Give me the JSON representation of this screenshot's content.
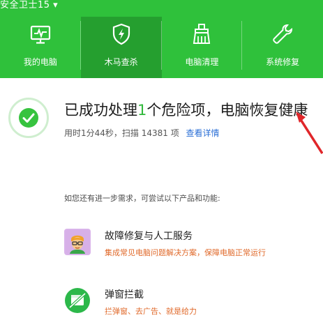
{
  "app": {
    "brand_text": "安全卫士15 ▾"
  },
  "nav": [
    {
      "label": "我的电脑",
      "icon": "monitor-pulse-icon",
      "active": false
    },
    {
      "label": "木马查杀",
      "icon": "shield-bolt-icon",
      "active": true
    },
    {
      "label": "电脑清理",
      "icon": "broom-icon",
      "active": false
    },
    {
      "label": "系统修复",
      "icon": "wrench-icon",
      "active": false
    }
  ],
  "result": {
    "headline_pre": "已成功处理",
    "headline_num": "1",
    "headline_post": "个危险项，电脑恢复健康",
    "summary": "用时1分44秒，扫描 14381 项",
    "detail_link": "查看详情"
  },
  "hint": "如您还有进一步需求，可尝试以下产品和功能:",
  "recommendations": [
    {
      "title": "故障修复与人工服务",
      "desc": "集成常见电脑问题解决方案，保障电脑正常运行",
      "icon": "technician-avatar-icon"
    },
    {
      "title": "弹窗拦截",
      "desc": "拦弹窗、去广告、就是给力",
      "icon": "popup-block-icon"
    }
  ],
  "colors": {
    "brand_green": "#2fc13b",
    "active_tab": "#259f2f",
    "link_blue": "#2b6fd6",
    "desc_orange": "#e06a2b",
    "arrow_red": "#e0262a"
  }
}
